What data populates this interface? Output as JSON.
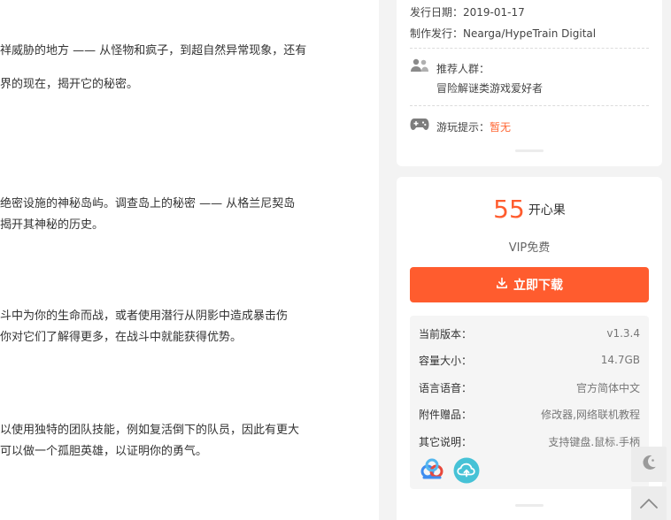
{
  "article": {
    "paragraphs": [
      "祥威胁的地方 —— 从怪物和疯子，到超自然异常现象，还有",
      "界的现在，揭开它的秘密。",
      "绝密设施的神秘岛屿。调查岛上的秘密 —— 从格兰尼契岛",
      "揭开其神秘的历史。",
      "斗中为你的生命而战，或者使用潜行从阴影中造成暴击伤",
      "你对它们了解得更多，在战斗中就能获得优势。",
      "以使用独特的团队技能，例如复活倒下的队员，因此有更大",
      "可以做一个孤胆英雄，以证明你的勇气。"
    ]
  },
  "game_info": {
    "release_date": "发行日期：2019-01-17",
    "publisher": "制作发行：Nearga/HypeTrain Digital",
    "audience_label": "推荐人群：",
    "audience_value": "冒险解谜类游戏爱好者",
    "hint_label": "游玩提示：",
    "hint_value": "暂无"
  },
  "download": {
    "price": "55",
    "price_unit": "开心果",
    "vip_text": "VIP免费",
    "button_label": "立即下载",
    "rows": [
      {
        "key": "当前版本：",
        "value": "v1.3.4"
      },
      {
        "key": "容量大小：",
        "value": "14.7GB"
      },
      {
        "key": "语言语音：",
        "value": "官方简体中文"
      },
      {
        "key": "附件赠品：",
        "value": "修改器,网络联机教程"
      },
      {
        "key": "其它说明：",
        "value": "支持键盘.鼠标.手柄"
      }
    ]
  },
  "colors": {
    "accent": "#ff5c2e",
    "panel_bg": "#f3f3f3"
  },
  "icons": {
    "audience": "users-icon",
    "hint": "gamepad-icon",
    "download": "download-icon",
    "share_1": "cloud-share-icon",
    "share_2": "cloud-upload-icon",
    "night": "moon-icon",
    "top": "chevron-up-icon"
  }
}
